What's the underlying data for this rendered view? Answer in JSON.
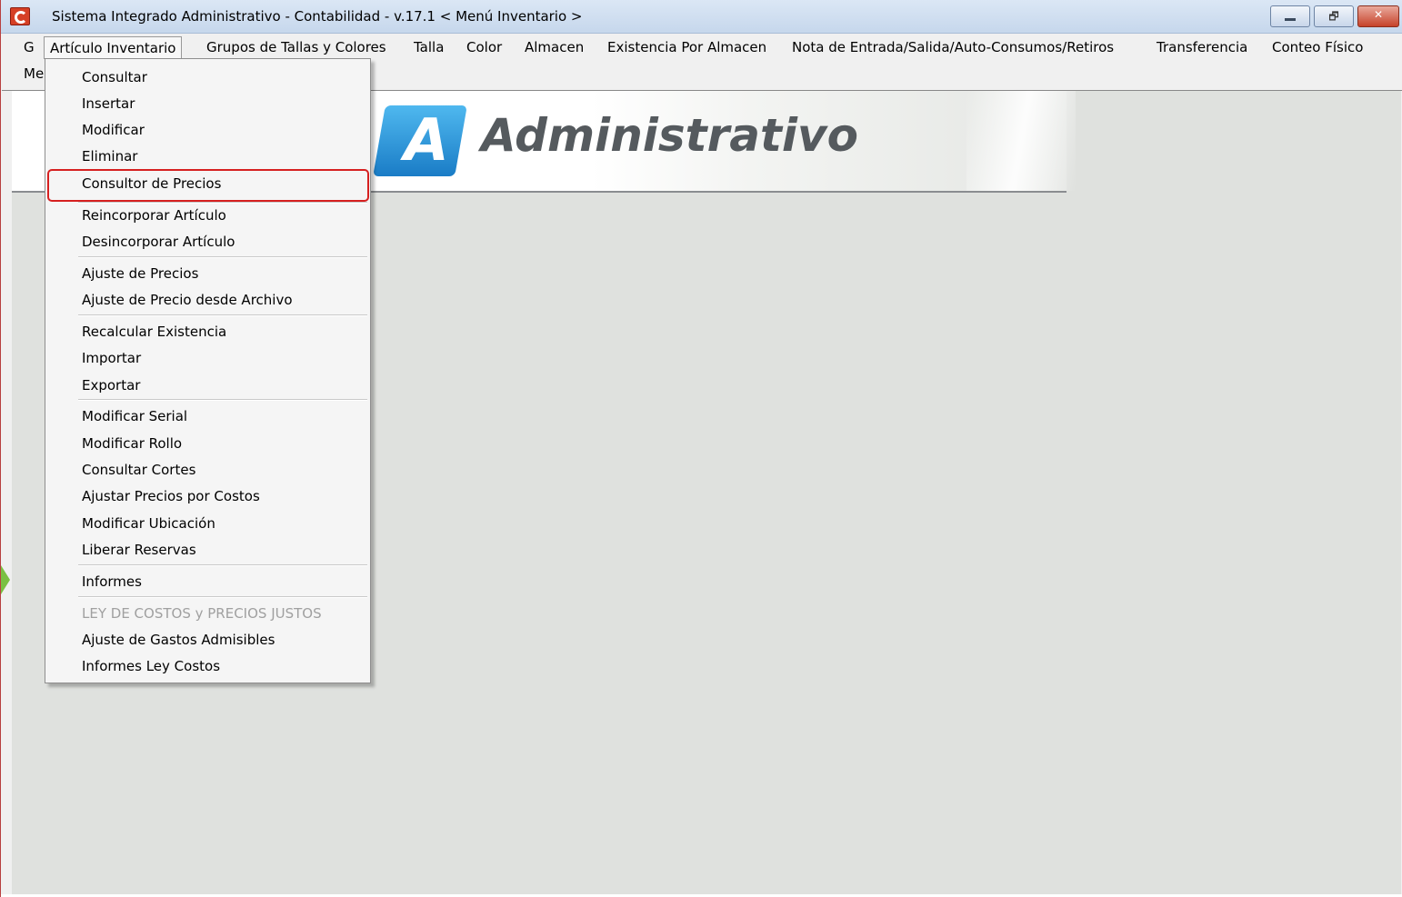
{
  "window": {
    "title": "Sistema Integrado Administrativo - Contabilidad - v.17.1 < Menú Inventario >",
    "controls": {
      "restore_glyph": "🗗",
      "close_glyph": "✕"
    }
  },
  "menubar": {
    "row1": [
      {
        "label": "G",
        "key": "g"
      },
      {
        "label": "Artículo Inventario",
        "key": "articulo-inventario",
        "active": true
      },
      {
        "label": "Grupos de Tallas y Colores",
        "key": "grupos-tallas-colores"
      },
      {
        "label": "Talla",
        "key": "talla"
      },
      {
        "label": "Color",
        "key": "color"
      },
      {
        "label": "Almacen",
        "key": "almacen"
      },
      {
        "label": "Existencia Por Almacen",
        "key": "existencia-por-almacen"
      },
      {
        "label": "Nota de Entrada/Salida/Auto-Consumos/Retiros",
        "key": "nota-entrada-salida"
      },
      {
        "label": "Transferencia",
        "key": "transferencia"
      },
      {
        "label": "Conteo Físico",
        "key": "conteo-fisico"
      }
    ],
    "row2": [
      {
        "label": "Me",
        "key": "me"
      }
    ]
  },
  "banner": {
    "logo_letter": "A",
    "title": "Administrativo"
  },
  "dropdown": {
    "items": [
      {
        "label": "Consultar"
      },
      {
        "label": "Insertar"
      },
      {
        "label": "Modificar"
      },
      {
        "label": "Eliminar"
      },
      {
        "label": "Consultor de Precios",
        "highlighted": true
      },
      {
        "label": "Reincorporar Artículo"
      },
      {
        "label": "Desincorporar Artículo"
      },
      {
        "label": "Ajuste de Precios"
      },
      {
        "label": "Ajuste de Precio desde Archivo"
      },
      {
        "label": "Recalcular Existencia"
      },
      {
        "label": "Importar"
      },
      {
        "label": "Exportar"
      },
      {
        "label": "Modificar Serial"
      },
      {
        "label": "Modificar Rollo"
      },
      {
        "label": "Consultar Cortes"
      },
      {
        "label": "Ajustar Precios por Costos"
      },
      {
        "label": "Modificar Ubicación"
      },
      {
        "label": "Liberar Reservas"
      },
      {
        "label": "Informes"
      },
      {
        "label": "LEY DE COSTOS y PRECIOS JUSTOS",
        "disabled": true
      },
      {
        "label": "Ajuste de Gastos Admisibles"
      },
      {
        "label": "Informes Ley Costos"
      }
    ]
  },
  "colors": {
    "highlight_border": "#d62020",
    "logo_blue": "#1a7cc6",
    "client_background": "#dfe1de",
    "arrow_green": "#7ac043"
  }
}
